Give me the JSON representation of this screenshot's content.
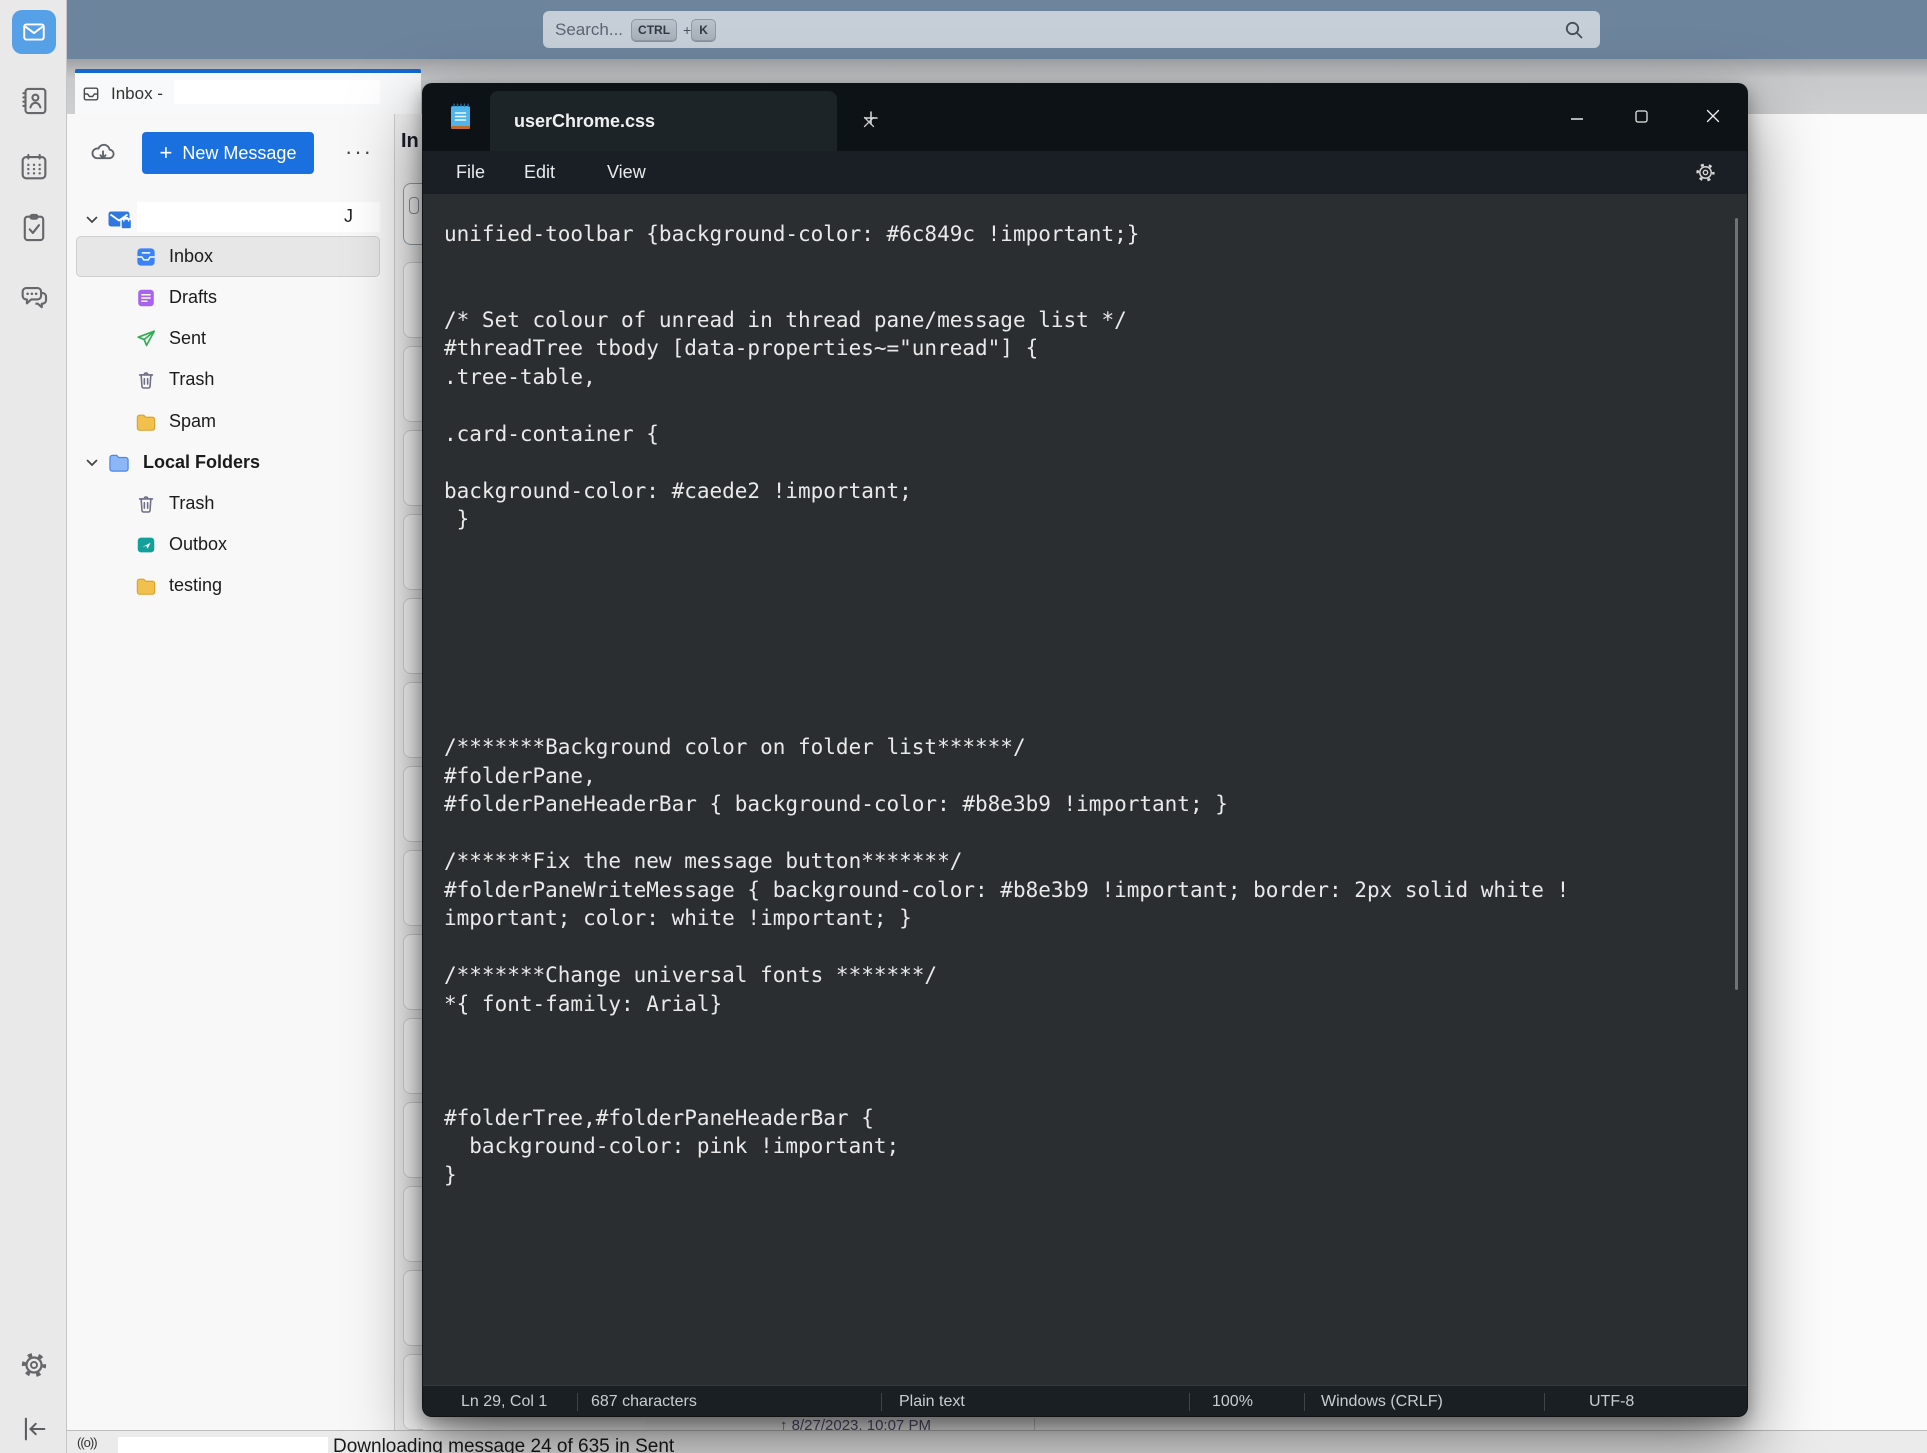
{
  "colors": {
    "unified_toolbar": "#6c849c",
    "accent_blue": "#1b70e0",
    "tab_indicator": "#1567d2",
    "notepad_titlebar": "#0c1216",
    "notepad_editor": "#2a2e30",
    "folder_pane_bg": "#f8f8f9"
  },
  "unified_toolbar": {
    "search": {
      "placeholder": "Search...",
      "shortcut_key_1": "CTRL",
      "shortcut_plus": "+",
      "shortcut_key_2": "K",
      "icon": "search-icon"
    }
  },
  "tab_bar": {
    "active_tab": {
      "icon": "inbox-tab-icon",
      "label": "Inbox -",
      "redacted": true
    }
  },
  "folder_pane": {
    "get_messages_icon": "cloud-download-icon",
    "new_message_plus": "+",
    "new_message_label": "New Message",
    "more_options_icon": "kebab-icon",
    "kebab_glyph": "···",
    "account": {
      "visible_suffix": "J",
      "icon": "account-mail-lock-icon",
      "redacted": true
    },
    "folders": [
      {
        "label": "Inbox",
        "icon": "inbox-icon",
        "selected": true
      },
      {
        "label": "Drafts",
        "icon": "drafts-icon"
      },
      {
        "label": "Sent",
        "icon": "sent-icon"
      },
      {
        "label": "Trash",
        "icon": "trash-icon"
      },
      {
        "label": "Spam",
        "icon": "folder-icon"
      },
      {
        "label": "Local Folders",
        "icon": "local-folders-icon",
        "bold": true
      },
      {
        "label": "Trash",
        "icon": "trash-icon"
      },
      {
        "label": "Outbox",
        "icon": "outbox-icon"
      },
      {
        "label": "testing",
        "icon": "folder-icon"
      }
    ]
  },
  "thread_pane": {
    "header_label": "In",
    "card_count": 14
  },
  "peek_row": {
    "sort_arrow": "↑",
    "date_text": "8/27/2023, 10:07 PM"
  },
  "tb_status_bar": {
    "network_icon_glyph": "((o))",
    "message": "Downloading message 24 of 635 in Sent"
  },
  "notepad": {
    "app_icon": "notepad-icon",
    "tab_title": "userChrome.css",
    "menu": {
      "file": "File",
      "edit": "Edit",
      "view": "View"
    },
    "settings_icon": "gear-icon",
    "code_lines": [
      "unified-toolbar {background-color: #6c849c !important;}",
      "",
      "",
      "/* Set colour of unread in thread pane/message list */",
      "#threadTree tbody [data-properties~=\"unread\"] {",
      ".tree-table,",
      "",
      ".card-container {",
      "",
      "background-color: #caede2 !important;",
      " }",
      "",
      "",
      "",
      "",
      "",
      "",
      "",
      "/*******Background color on folder list******/",
      "#folderPane,",
      "#folderPaneHeaderBar { background-color: #b8e3b9 !important; }",
      "",
      "/******Fix the new message button*******/",
      "#folderPaneWriteMessage { background-color: #b8e3b9 !important; border: 2px solid white !",
      "important; color: white !important; }",
      "",
      "/*******Change universal fonts *******/",
      "*{ font-family: Arial}",
      "",
      "",
      "",
      "#folderTree,#folderPaneHeaderBar {",
      "  background-color: pink !important;",
      "}"
    ],
    "status": {
      "position": "Ln 29, Col 1",
      "characters": "687 characters",
      "format": "Plain text",
      "zoom": "100%",
      "line_ending": "Windows (CRLF)",
      "encoding": "UTF-8"
    }
  }
}
